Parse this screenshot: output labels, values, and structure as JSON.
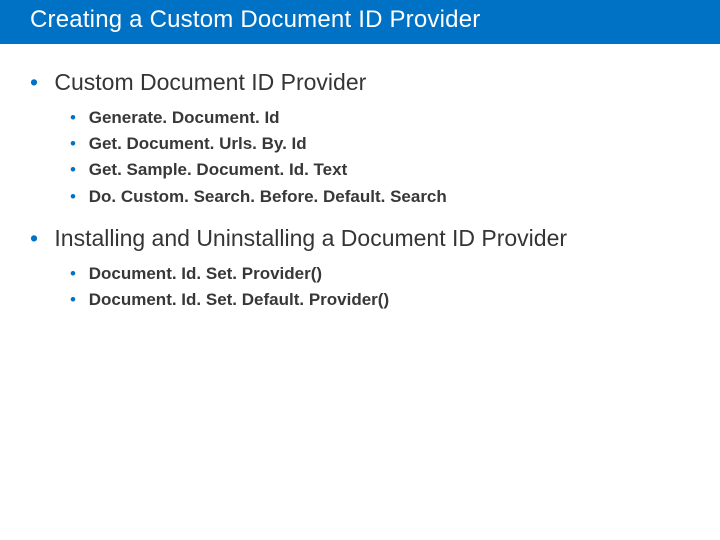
{
  "title": "Creating a Custom Document ID Provider",
  "sections": [
    {
      "heading": "Custom Document ID Provider",
      "items": [
        "Generate. Document. Id",
        "Get. Document. Urls. By. Id",
        "Get. Sample. Document. Id. Text",
        "Do. Custom. Search. Before. Default. Search"
      ]
    },
    {
      "heading": "Installing and Uninstalling a Document ID Provider",
      "items": [
        "Document. Id. Set. Provider()",
        "Document. Id. Set. Default. Provider()"
      ]
    }
  ],
  "colors": {
    "accent": "#0072c6",
    "text": "#383838"
  }
}
